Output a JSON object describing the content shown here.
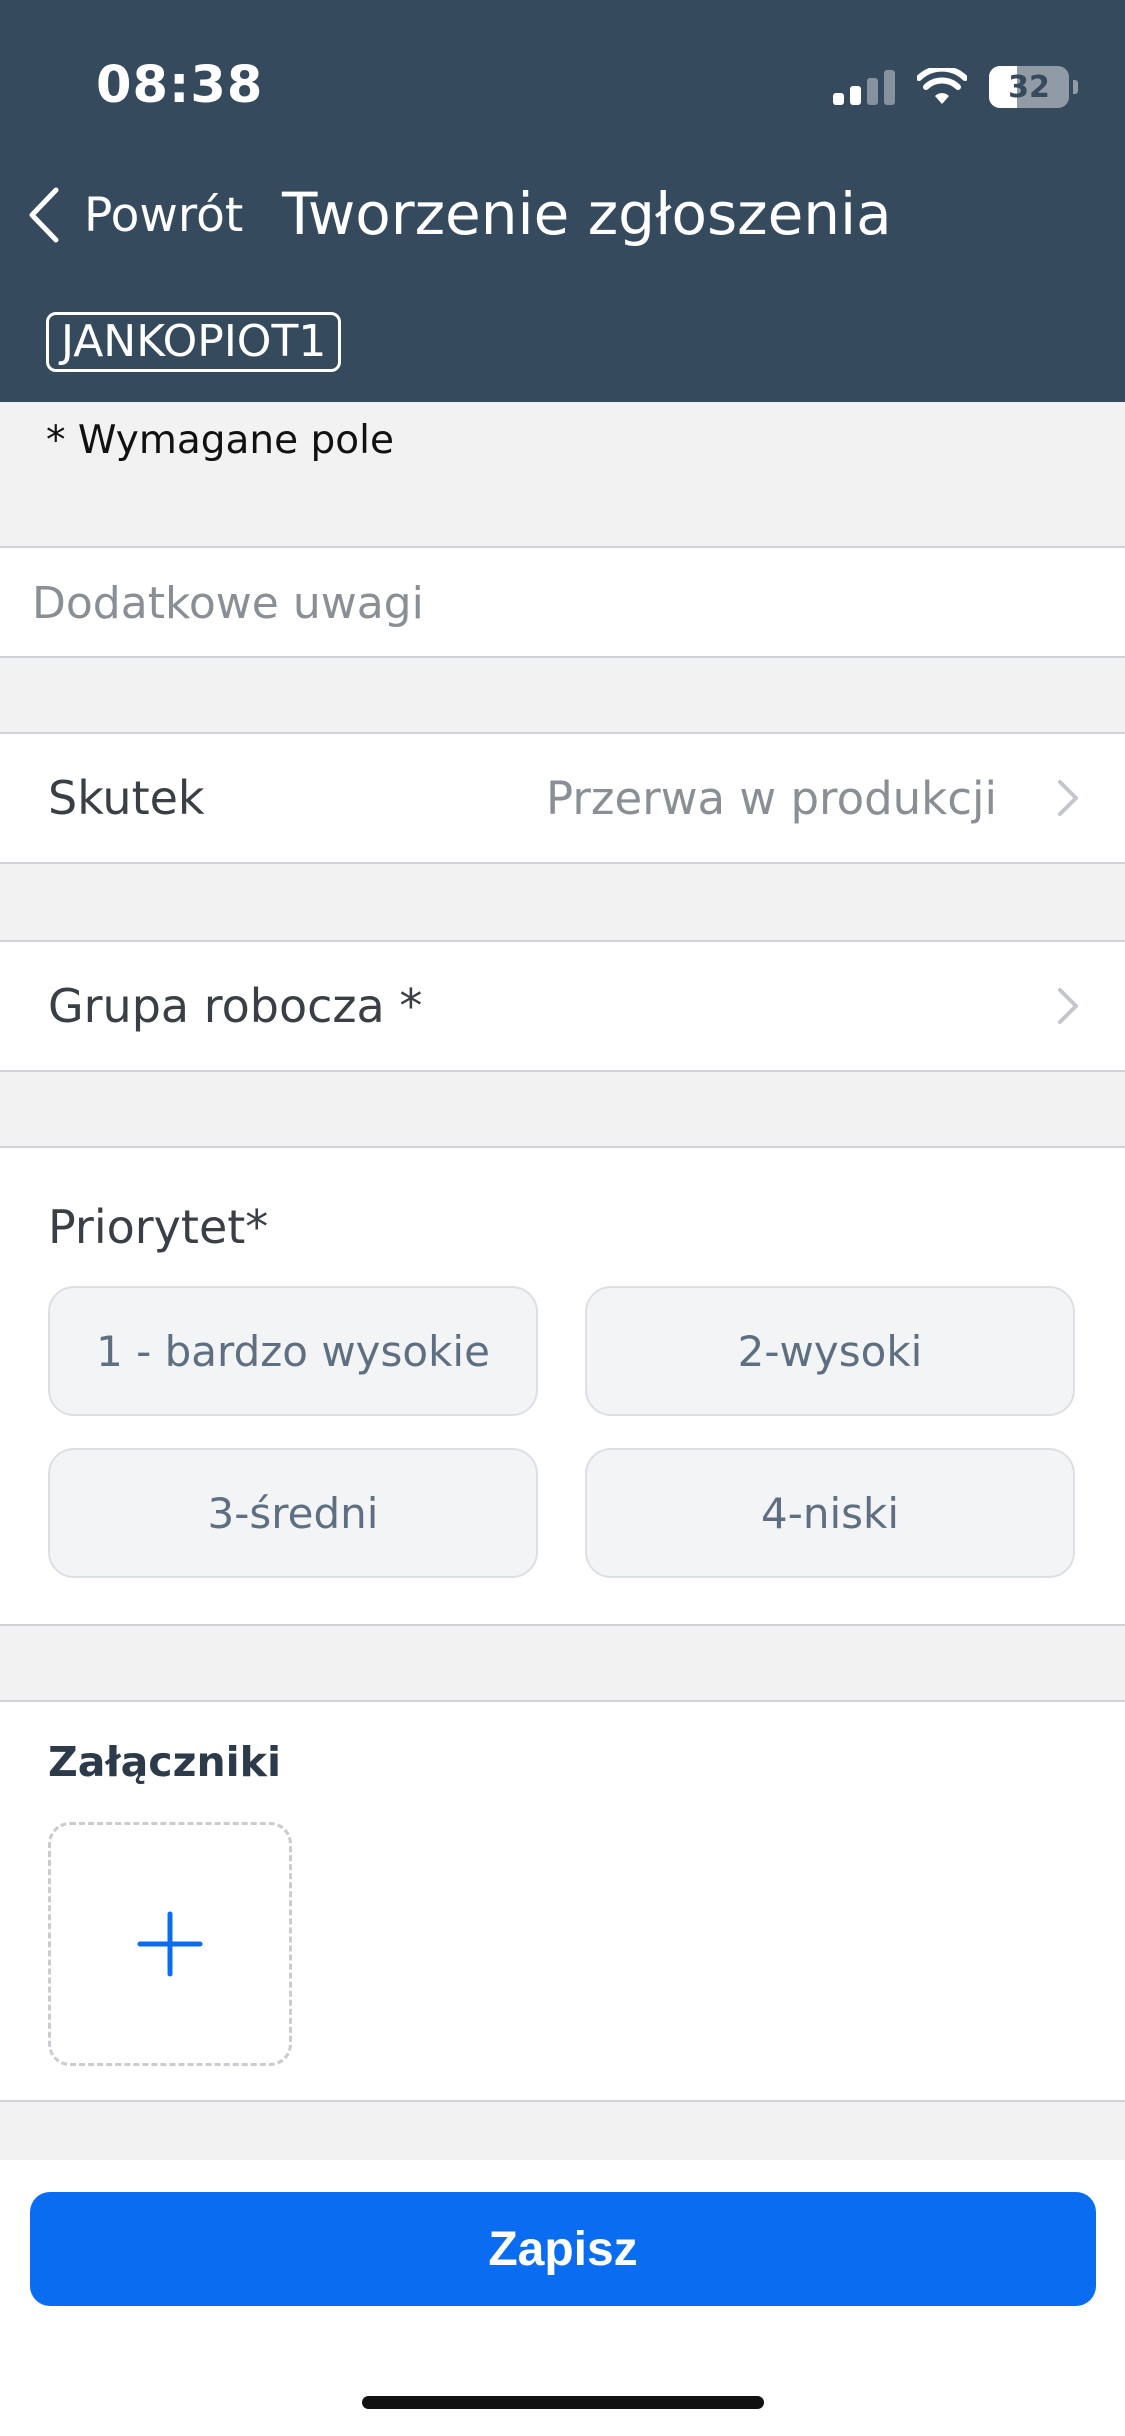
{
  "status_bar": {
    "time": "08:38",
    "battery_level": "32",
    "icons": [
      "signal-icon",
      "wifi-icon",
      "battery-icon"
    ]
  },
  "nav": {
    "back_label": "Powrót",
    "title": "Tworzenie zgłoszenia",
    "user_badge": "JANKOPIOT1"
  },
  "form": {
    "required_note": "* Wymagane pole",
    "notes": {
      "placeholder": "Dodatkowe uwagi",
      "value": ""
    },
    "effect": {
      "label": "Skutek",
      "value": "Przerwa w produkcji"
    },
    "workgroup": {
      "label": "Grupa robocza *",
      "value": ""
    },
    "priority": {
      "label": "Priorytet*",
      "options": [
        "1 - bardzo wysokie",
        "2-wysoki",
        "3-średni",
        "4-niski"
      ]
    },
    "attachments": {
      "label": "Załączniki"
    }
  },
  "actions": {
    "save_label": "Zapisz"
  },
  "colors": {
    "header_bg": "#364a5e",
    "accent": "#0a6cf0",
    "page_bg": "#f2f2f3"
  }
}
